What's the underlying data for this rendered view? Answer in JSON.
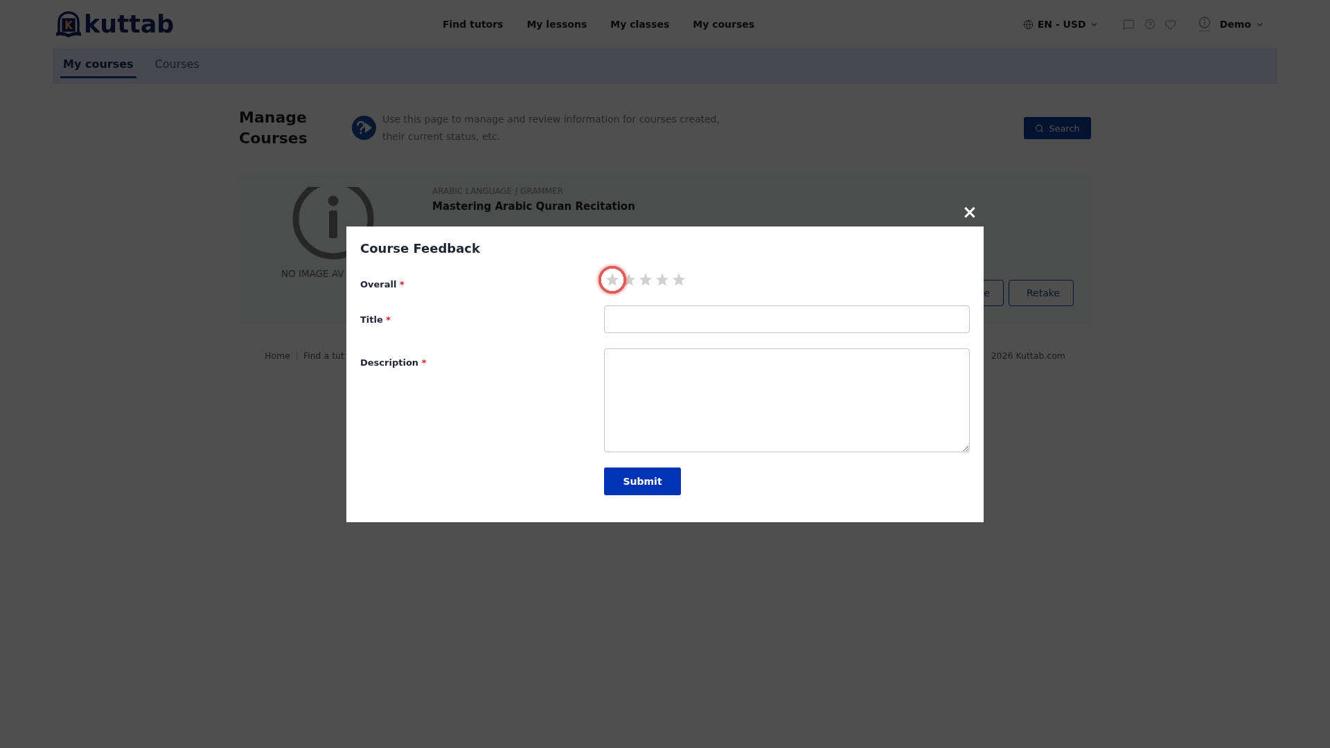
{
  "header": {
    "logo": {
      "letter": "K",
      "name": "kuttab"
    },
    "nav": [
      "Find tutors",
      "My lessons",
      "My classes",
      "My courses"
    ],
    "locale": "EN - USD",
    "user": "Demo"
  },
  "subnav": {
    "tabs": [
      {
        "label": "My courses",
        "selected": true
      },
      {
        "label": "Courses",
        "selected": false
      }
    ]
  },
  "page": {
    "title": "Manage Courses",
    "description": "Use this page to manage and review information for courses created, their current status, etc.",
    "search_button": "Search"
  },
  "course_card": {
    "image_text": "NO IMAGE AV",
    "category": "ARABIC LANGUAGE / GRAMMER",
    "title": "Mastering Arabic Quran Recitation",
    "buttons": [
      "e",
      "Retake"
    ]
  },
  "footer": {
    "links": [
      "Home",
      "Find a tut"
    ],
    "copyright": "2026 Kuttab.com"
  },
  "modal": {
    "close": "×",
    "title": "Course Feedback",
    "fields": [
      {
        "kind": "rating",
        "label": "Overall",
        "required_mark": "*",
        "stars": 0,
        "focused": true
      },
      {
        "kind": "text",
        "label": "Title",
        "required_mark": "*"
      },
      {
        "kind": "textarea",
        "label": "Description",
        "required_mark": "*"
      }
    ],
    "submit": "Submit"
  }
}
